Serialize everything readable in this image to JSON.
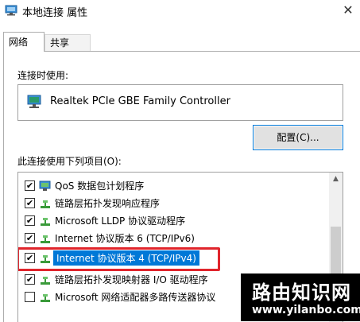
{
  "window": {
    "title": "本地连接 属性",
    "close_glyph": "✕"
  },
  "tabs": [
    {
      "label": "网络",
      "active": true
    },
    {
      "label": "共享",
      "active": false
    }
  ],
  "connect_using": {
    "label": "连接时使用:",
    "adapter": "Realtek PCIe GBE Family Controller"
  },
  "configure_button": "配置(C)...",
  "items_label": "此连接使用下列项目(O):",
  "items": [
    {
      "label": "QoS 数据包计划程序",
      "checked": true,
      "icon": "qos-scheduler-icon"
    },
    {
      "label": "链路层拓扑发现响应程序",
      "checked": true,
      "icon": "protocol-icon"
    },
    {
      "label": "Microsoft LLDP 协议驱动程序",
      "checked": true,
      "icon": "protocol-icon"
    },
    {
      "label": "Internet 协议版本 6 (TCP/IPv6)",
      "checked": true,
      "icon": "protocol-icon"
    },
    {
      "label": "Internet 协议版本 4 (TCP/IPv4)",
      "checked": true,
      "icon": "protocol-icon",
      "selected": true
    },
    {
      "label": "链路层拓扑发现映射器 I/O 驱动程序",
      "checked": true,
      "icon": "protocol-icon"
    },
    {
      "label": "Microsoft 网络适配器多路传送器协议",
      "checked": false,
      "icon": "protocol-icon"
    }
  ],
  "checkmark": "✔",
  "scroll_up_glyph": "▲",
  "colors": {
    "selection": "#0078d7",
    "highlight_border": "#e0252c"
  },
  "watermark": {
    "text": "路由知识网",
    "url": "www.yilanbo.com"
  }
}
